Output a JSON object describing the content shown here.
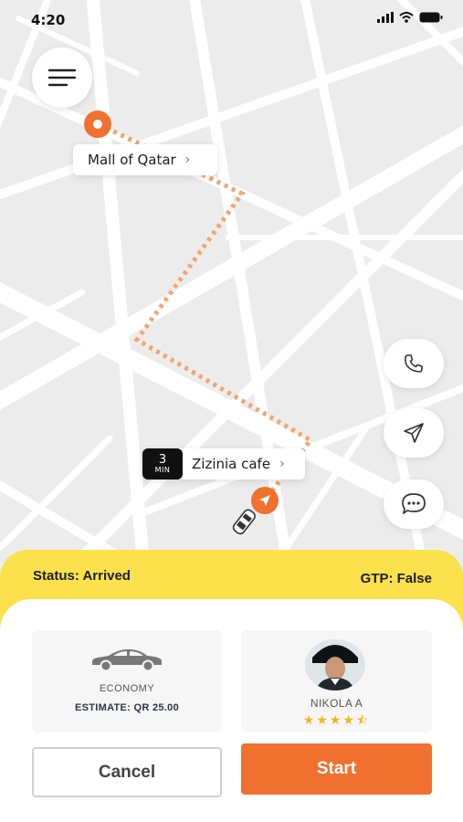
{
  "status_bar": {
    "time": "4:20"
  },
  "map": {
    "origin_label": "Mall of Qatar",
    "destination_label": "Zizinia cafe",
    "eta_value": "3",
    "eta_unit": "MIN"
  },
  "trip": {
    "status": "Status: Arrived",
    "gtp": "GTP: False"
  },
  "vehicle": {
    "type": "ECONOMY",
    "estimate": "ESTIMATE: QR 25.00"
  },
  "driver": {
    "name": "NIKOLA A",
    "rating": 4.5,
    "stars": "★★★★⯪"
  },
  "actions": {
    "cancel_label": "Cancel",
    "start_label": "Start"
  },
  "colors": {
    "accent": "#f0702e",
    "status_yellow": "#fbe14b",
    "star": "#f2b51e"
  },
  "icons": [
    "menu-icon",
    "phone-icon",
    "send-icon",
    "chat-icon",
    "navigation-arrow-icon",
    "car-icon",
    "chevron-right-icon",
    "signal-icon",
    "wifi-icon",
    "battery-icon"
  ]
}
